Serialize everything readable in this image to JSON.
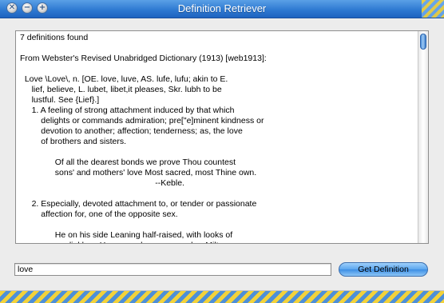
{
  "window": {
    "title": "Definition Retriever",
    "controls": {
      "close": "✕",
      "minimize": "−",
      "zoom": "+"
    }
  },
  "output": {
    "lines": [
      "7 definitions found",
      "",
      "From Webster's Revised Unabridged Dictionary (1913) [web1913]:",
      "",
      "  Love \\Love\\, n. [OE. love, luve, AS. lufe, lufu; akin to E.",
      "     lief, believe, L. lubet, libet,it pleases, Skr. lubh to be",
      "     lustful. See {Lief}.]",
      "     1. A feeling of strong attachment induced by that which",
      "         delights or commands admiration; pre[\"e]minent kindness or",
      "         devotion to another; affection; tenderness; as, the love",
      "         of brothers and sisters.",
      "",
      "               Of all the dearest bonds we prove Thou countest",
      "               sons' and mothers' love Most sacred, most Thine own.",
      "                                                          --Keble.",
      "",
      "     2. Especially, devoted attachment to, or tender or passionate",
      "         affection for, one of the opposite sex.",
      "",
      "               He on his side Leaning half-raised, with looks of",
      "               cordial love Hung over her enamored.  --Milton."
    ],
    "scroll_position": 0.0
  },
  "search": {
    "value": "love",
    "button_label": "Get Definition"
  },
  "colors": {
    "titlebar": "#2f7ad2",
    "stripe_yellow": "#f3d23a",
    "stripe_blue": "#4d8fd8",
    "button_blue": "#5ba6ee"
  }
}
